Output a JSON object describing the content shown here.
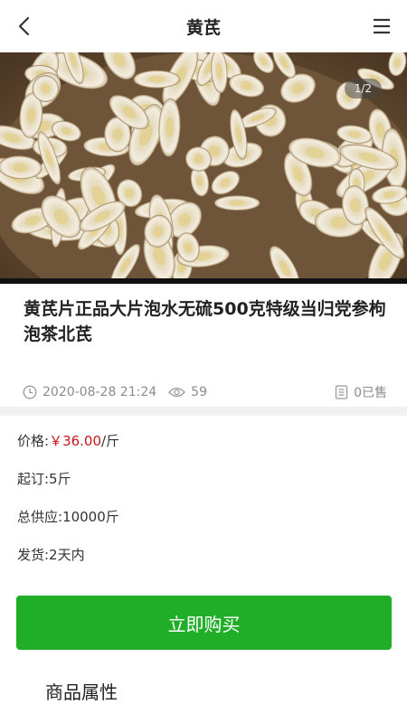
{
  "header": {
    "title": "黄芪",
    "back_icon": "chevron-left-icon",
    "menu_icon": "hamburger-menu-icon"
  },
  "gallery": {
    "counter": "1/2",
    "image_desc": "product-photo-sliced-astragalus-root"
  },
  "product": {
    "title": "黄芪片正品大片泡水无硫500克特级当归党参枸泡茶北芪",
    "date": "2020-08-28 21:24",
    "views": "59",
    "sold": "0已售"
  },
  "details": {
    "price_label": "价格:",
    "price_value": "￥36.00",
    "price_unit": "/斤",
    "min_order": "起订:5斤",
    "supply": "总供应:10000斤",
    "shipping": "发货:2天内"
  },
  "actions": {
    "buy_label": "立即购买"
  },
  "sections": {
    "attributes_title": "商品属性"
  },
  "colors": {
    "accent_green": "#20ad28",
    "price_red": "#c8161d"
  }
}
